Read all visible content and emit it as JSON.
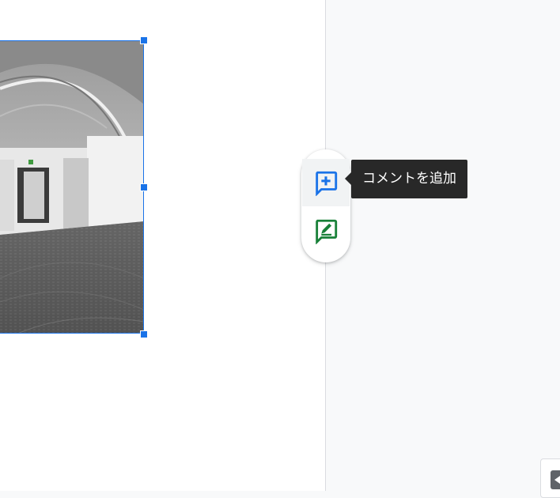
{
  "image": {
    "alt_icon": "panorama-photo",
    "selection_color": "#1a73e8"
  },
  "side_toolbar": {
    "add_comment_icon": "add-comment-icon",
    "suggest_edits_icon": "suggest-edits-icon",
    "add_comment_color": "#1a73e8",
    "suggest_edits_color": "#188038"
  },
  "tooltip": {
    "text": "コメントを追加"
  },
  "colors": {
    "canvas_bg": "#f8f9fa",
    "page_bg": "#ffffff",
    "tooltip_bg": "#282828"
  }
}
